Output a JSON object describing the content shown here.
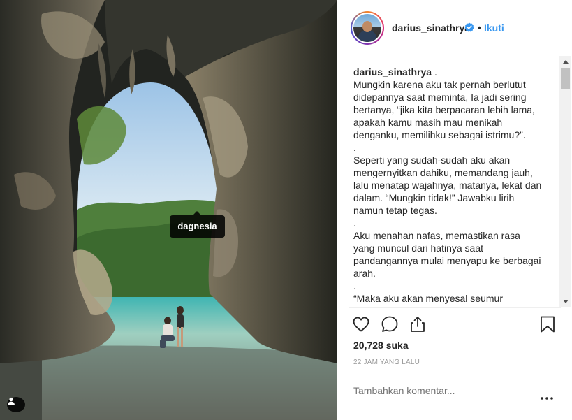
{
  "photo": {
    "tag_label": "dagnesia"
  },
  "header": {
    "username": "darius_sinathrya",
    "separator": "•",
    "follow_label": "Ikuti"
  },
  "caption": {
    "username": "darius_sinathrya",
    "text": " .\nMungkin karena aku tak pernah berlutut didepannya saat meminta, Ia jadi sering bertanya, “jika kita berpacaran lebih lama, apakah kamu masih mau menikah denganku, memilihku sebagai istrimu?”.\n.\nSeperti yang sudah-sudah aku akan mengernyitkan dahiku, memandang jauh, lalu menatap wajahnya, matanya, lekat dan dalam. “Mungkin tidak!” Jawabku lirih namun tetap tegas.\n.\nAku menahan nafas, memastikan rasa yang muncul dari hatinya saat pandangannya mulai menyapu ke berbagai arah.\n.\n“Maka aku akan menyesal seumur hidupku, telah melewatkan kesempatan untuk menghabiskan sisa hidupku bersama"
  },
  "stats": {
    "likes": "20,728 suka",
    "time": "22 JAM YANG LALU"
  },
  "comment": {
    "placeholder": "Tambahkan komentar..."
  },
  "icons": {
    "like": "heart-icon",
    "comment": "comment-icon",
    "share": "share-icon",
    "save": "bookmark-icon",
    "more": "more-icon",
    "verified": "verified-badge-icon",
    "user_tag": "user-tag-icon"
  },
  "colors": {
    "link": "#3897f0",
    "verified": "#3897f0",
    "text": "#262626",
    "muted": "#999999"
  }
}
